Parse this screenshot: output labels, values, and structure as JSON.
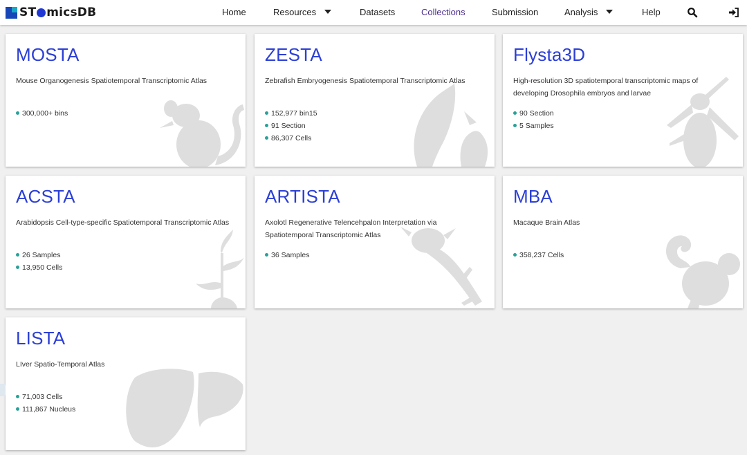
{
  "brand": {
    "prefix": "ST",
    "suffix": "micsDB"
  },
  "nav": {
    "items": [
      {
        "label": "Home"
      },
      {
        "label": "Resources"
      },
      {
        "label": "Datasets"
      },
      {
        "label": "Collections"
      },
      {
        "label": "Submission"
      },
      {
        "label": "Analysis"
      },
      {
        "label": "Help"
      }
    ],
    "active": "Collections",
    "icons": [
      "search-icon",
      "sign-in-icon"
    ]
  },
  "cards": [
    {
      "title": "MOSTA",
      "description": "Mouse Organogenesis Spatiotemporal Transcriptomic Atlas",
      "stats": [
        "300,000+ bins"
      ],
      "icon": "mouse-icon"
    },
    {
      "title": "ZESTA",
      "description": "Zebrafish Embryogenesis Spatiotemporal Transcriptomic Atlas",
      "stats": [
        "152,977 bin15",
        "91 Section",
        "86,307 Cells"
      ],
      "icon": "fish-icon"
    },
    {
      "title": "Flysta3D",
      "description": "High-resolution 3D spatiotemporal transcriptomic maps of developing Drosophila embryos and larvae",
      "stats": [
        "90 Section",
        "5 Samples"
      ],
      "icon": "fly-icon"
    },
    {
      "title": "ACSTA",
      "description": "Arabidopsis Cell-type-specific Spatiotemporal Transcriptomic Atlas",
      "stats": [
        "26 Samples",
        "13,950 Cells"
      ],
      "icon": "plant-icon"
    },
    {
      "title": "ARTISTA",
      "description": "Axolotl Regenerative Telencehpalon Interpretation via Spatiotemporal Transcriptomic Atlas",
      "stats": [
        "36 Samples"
      ],
      "icon": "axolotl-icon"
    },
    {
      "title": "MBA",
      "description": "Macaque Brain Atlas",
      "stats": [
        "358,237 Cells"
      ],
      "icon": "monkey-icon"
    },
    {
      "title": "LISTA",
      "description": "LIver Spatio-Temporal Atlas",
      "stats": [
        "71,003 Cells",
        "111,867 Nucleus"
      ],
      "icon": "liver-icon"
    }
  ],
  "colors": {
    "title": "#2b3fd6",
    "bullet": "#2aa198",
    "brand_blue": "#1f38d4",
    "active_nav": "#4a2c8c",
    "silhouette": "#dedede"
  }
}
